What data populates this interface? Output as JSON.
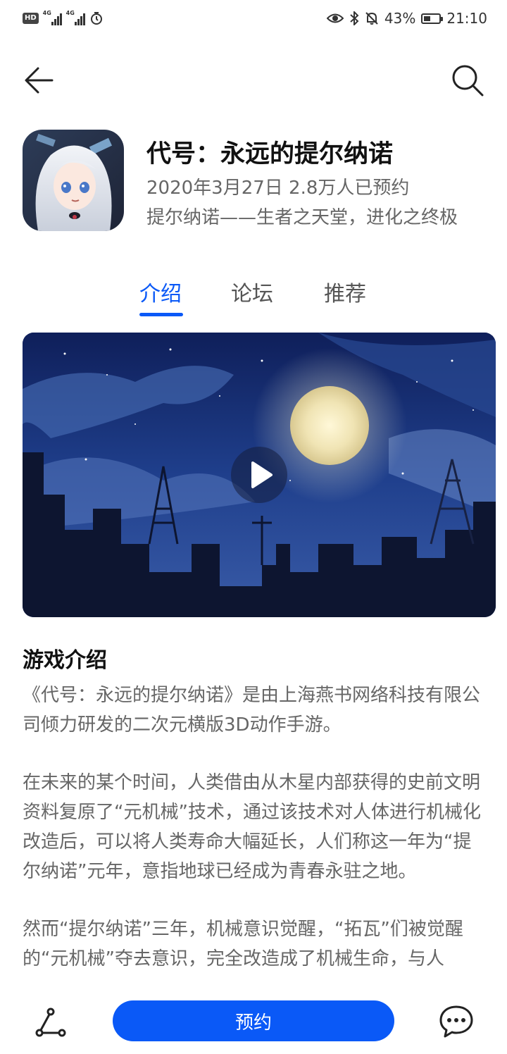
{
  "status_bar": {
    "left_badge": "HD",
    "network_1": "4G",
    "network_2": "4G",
    "battery_percent": "43%",
    "battery_level": 0.43,
    "time": "21:10",
    "icons": [
      "eye-comfort-icon",
      "bluetooth-icon",
      "mute-icon",
      "alarm-icon"
    ]
  },
  "header": {
    "back_icon": "arrow-left-icon",
    "search_icon": "search-icon"
  },
  "app": {
    "title": "代号：永远的提尔纳诺",
    "meta": "2020年3月27日 2.8万人已预约",
    "tagline": "提尔纳诺——生者之天堂，进化之终极"
  },
  "tabs": [
    {
      "label": "介绍",
      "active": true
    },
    {
      "label": "论坛",
      "active": false
    },
    {
      "label": "推荐",
      "active": false
    }
  ],
  "video": {
    "play_icon": "play-icon"
  },
  "description": {
    "heading": "游戏介绍",
    "paragraphs": [
      "《代号：永远的提尔纳诺》是由上海燕书网络科技有限公司倾力研发的二次元横版3D动作手游。",
      "在未来的某个时间，人类借由从木星内部获得的史前文明资料复原了“元机械”技术，通过该技术对人体进行机械化改造后，可以将人类寿命大幅延长，人们称这一年为“提尔纳诺”元年，意指地球已经成为青春永驻之地。",
      "然而“提尔纳诺”三年，机械意识觉醒，“拓瓦”们被觉醒的“元机械”夺去意识，完全改造成了机械生命，与人"
    ]
  },
  "bottom_bar": {
    "share_icon": "share-icon",
    "reserve_label": "预约",
    "chat_icon": "chat-icon"
  },
  "colors": {
    "accent": "#0a59f7",
    "text_primary": "#111111",
    "text_secondary": "#666666"
  }
}
